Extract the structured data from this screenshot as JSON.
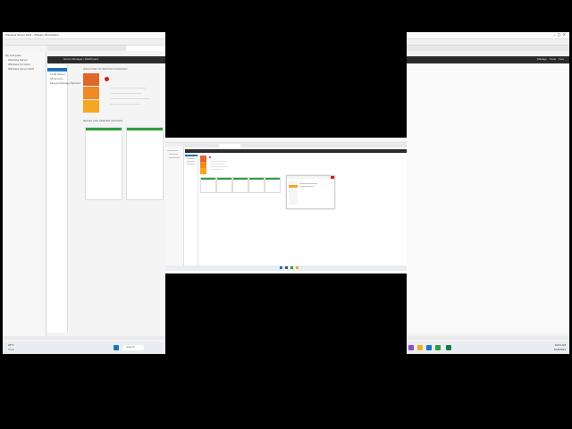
{
  "colors": {
    "letterbox": "#000000",
    "background_window": "#f2f2f2",
    "title_dark": "#2b2b2b",
    "accent_blue": "#1e73be",
    "orange1": "#e0662c",
    "orange2": "#f08a24",
    "orange3": "#f6a623",
    "alert_red": "#cc1f1f",
    "green_ok": "#2e9e3f",
    "taskbar": "#e9edf2"
  },
  "left_window": {
    "title": "Windows Server 2022 - VMware Workstation",
    "header_title": "Server Manager • Dashboard",
    "tree_items": [
      "My Computer",
      "Windows Server",
      "Windows 10 Client",
      "Windows Server 2022"
    ],
    "nav_items": [
      "Dashboard",
      "Local Server",
      "All Servers",
      "File and Storage Services"
    ],
    "tiles_section_label": "ROLES AND SERVER GROUPS",
    "welcome_label": "WELCOME TO SERVER MANAGER",
    "search_label": "Search",
    "weather_temp": "24°C",
    "weather_desc": "Clear"
  },
  "center_window": {
    "menu_items": [
      "File",
      "Edit",
      "View",
      "VM",
      "Tabs",
      "Help"
    ],
    "tab_label": "Windows Server 2022",
    "tiles": [
      {
        "title": "AD DS",
        "count": "1"
      },
      {
        "title": "DNS",
        "count": "1"
      },
      {
        "title": "File and Storage Services",
        "count": "1"
      },
      {
        "title": "Local Server",
        "count": "1"
      },
      {
        "title": "All Servers",
        "count": "1"
      }
    ],
    "dialog_title": "Add Roles and Features Wizard"
  },
  "right_window": {
    "header_items": [
      "Manage",
      "Tools",
      "View",
      "Help"
    ],
    "tray_time": "10:24 AM",
    "tray_date": "6/18/2024"
  }
}
